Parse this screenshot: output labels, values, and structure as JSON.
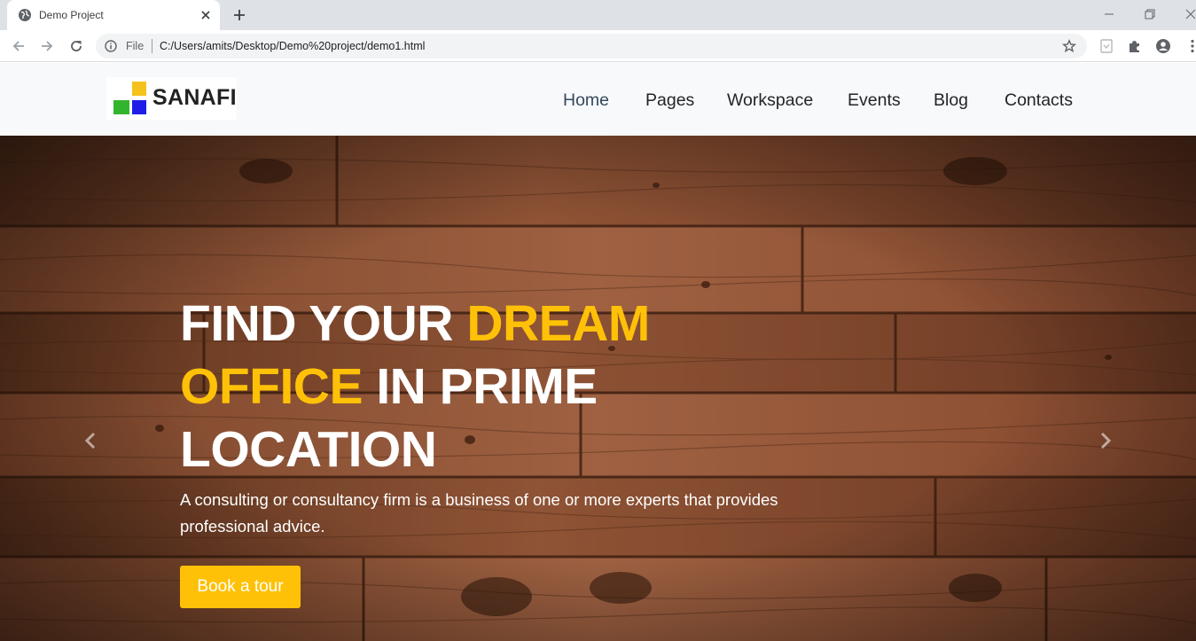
{
  "browser": {
    "tab_title": "Demo Project",
    "file_label": "File",
    "url": "C:/Users/amits/Desktop/Demo%20project/demo1.html"
  },
  "header": {
    "logo_text": "SANAFI",
    "logo_colors": {
      "top": "#f5c21b",
      "left": "#31b52d",
      "right": "#1f1ee8"
    },
    "nav": [
      {
        "label": "Home",
        "active": true
      },
      {
        "label": "Pages"
      },
      {
        "label": "Workspace"
      },
      {
        "label": "Events"
      },
      {
        "label": "Blog"
      },
      {
        "label": "Contacts"
      }
    ]
  },
  "hero": {
    "title_part1": "FIND YOUR ",
    "title_highlight1": "DREAM",
    "title_highlight2": "OFFICE",
    "title_part2": " IN PRIME LOCATION",
    "subtitle": "A consulting or consultancy firm is a business of one or more experts that provides professional advice.",
    "cta_label": "Book a tour",
    "accent_color": "#ffc107"
  },
  "icons": {
    "prev": "chevron-left-icon",
    "next": "chevron-right-icon"
  }
}
